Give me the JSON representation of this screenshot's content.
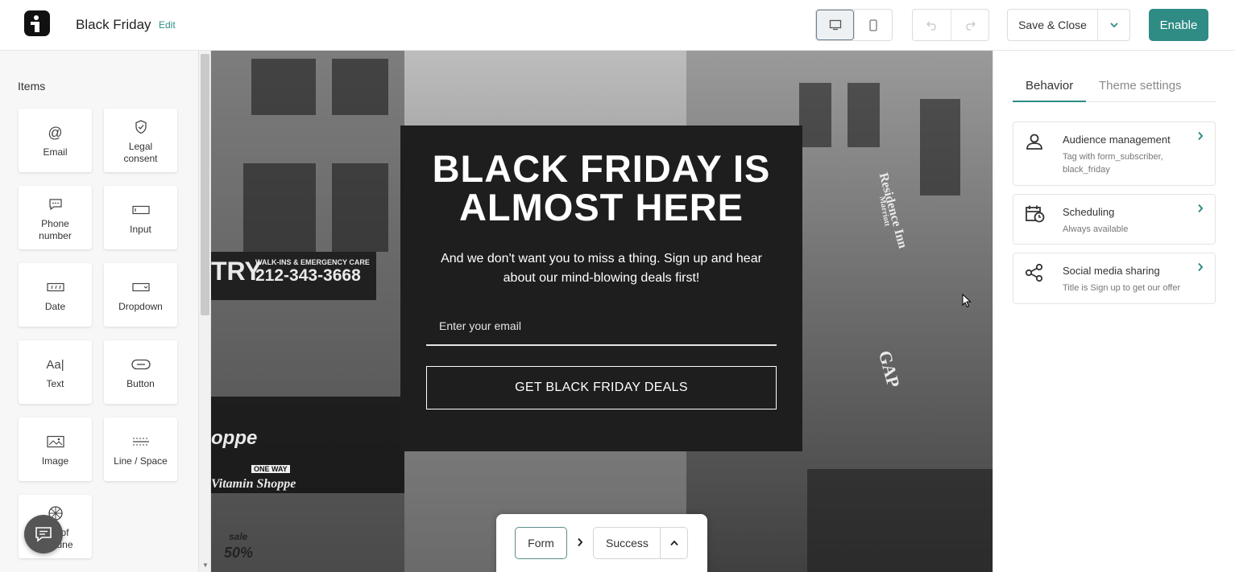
{
  "header": {
    "title": "Black Friday",
    "edit_label": "Edit",
    "save_label": "Save & Close",
    "enable_label": "Enable"
  },
  "sidebar": {
    "title": "Items",
    "items": [
      {
        "label": "Email",
        "icon": "at-icon"
      },
      {
        "label": "Legal consent",
        "icon": "shield-icon"
      },
      {
        "label": "Phone number",
        "icon": "chat-bubble-icon"
      },
      {
        "label": "Input",
        "icon": "input-box-icon"
      },
      {
        "label": "Date",
        "icon": "date-icon"
      },
      {
        "label": "Dropdown",
        "icon": "dropdown-icon"
      },
      {
        "label": "Text",
        "icon": "text-icon"
      },
      {
        "label": "Button",
        "icon": "button-icon"
      },
      {
        "label": "Image",
        "icon": "image-icon"
      },
      {
        "label": "Line / Space",
        "icon": "line-space-icon"
      },
      {
        "label_line1": "of",
        "label_line2": "une",
        "icon": "wheel-icon"
      }
    ]
  },
  "popup": {
    "headline": "BLACK FRIDAY IS ALMOST HERE",
    "body": "And we don't want you to miss a thing. Sign up and hear about our mind-blowing deals first!",
    "email_placeholder": "Enter your email",
    "cta_label": "GET BLACK FRIDAY DEALS"
  },
  "background_signs": {
    "sign_1": "WALK-INS & EMERGENCY CARE",
    "sign_2": "212-343-3668",
    "sign_3": "TRY",
    "sign_4": "Residence Inn",
    "sign_5": "Marriott",
    "sign_6": "GAP",
    "sign_7": "oppe",
    "sign_8": "ONE WAY",
    "sign_9": "Vitamin Shoppe",
    "sign_10": "sale",
    "sign_11": "50%"
  },
  "stepper": {
    "step_form": "Form",
    "step_success": "Success"
  },
  "right_panel": {
    "tab_behavior": "Behavior",
    "tab_theme": "Theme settings",
    "cards": [
      {
        "title": "Audience management",
        "subtitle": "Tag with form_subscriber, black_friday",
        "icon": "person-icon"
      },
      {
        "title": "Scheduling",
        "subtitle": "Always available",
        "icon": "calendar-clock-icon"
      },
      {
        "title": "Social media sharing",
        "subtitle": "Title is Sign up to get our offer",
        "icon": "share-icon"
      }
    ]
  },
  "colors": {
    "accent": "#2e8c85",
    "popup_bg": "#1e1e1e"
  }
}
